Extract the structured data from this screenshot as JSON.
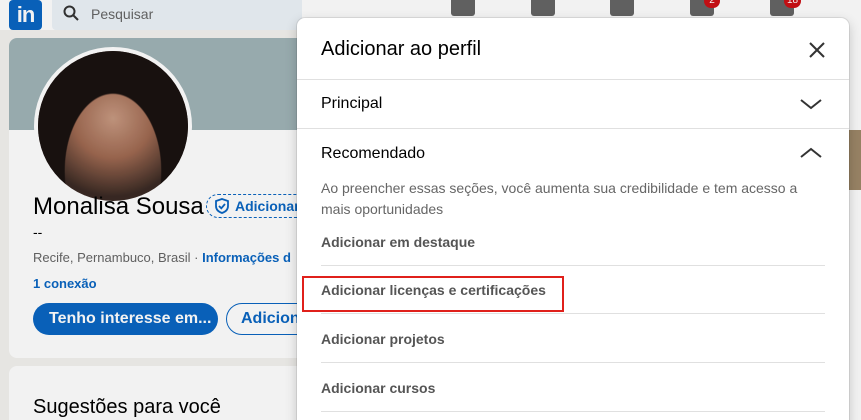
{
  "nav": {
    "logo": "in",
    "search_placeholder": "Pesquisar",
    "messaging_badge": "2",
    "notifications_badge": "18"
  },
  "profile": {
    "name": "Monalisa Sousa",
    "verify_label": "Adicionar",
    "headline": "--",
    "location": "Recife, Pernambuco, Brasil · ",
    "contact_link": "Informações d",
    "connections": "1 conexão",
    "primary_button": "Tenho interesse em...",
    "secondary_button": "Adicionar"
  },
  "suggestions": {
    "title": "Sugestões para você"
  },
  "modal": {
    "title": "Adicionar ao perfil",
    "sections": {
      "principal": "Principal",
      "recommended": "Recomendado"
    },
    "description": "Ao preencher essas seções, você aumenta sua credibilidade e tem acesso a mais oportunidades",
    "items": [
      "Adicionar em destaque",
      "Adicionar licenças e certificações",
      "Adicionar projetos",
      "Adicionar cursos"
    ]
  },
  "colors": {
    "brand": "#0a66c2",
    "highlight": "#e0201b"
  }
}
